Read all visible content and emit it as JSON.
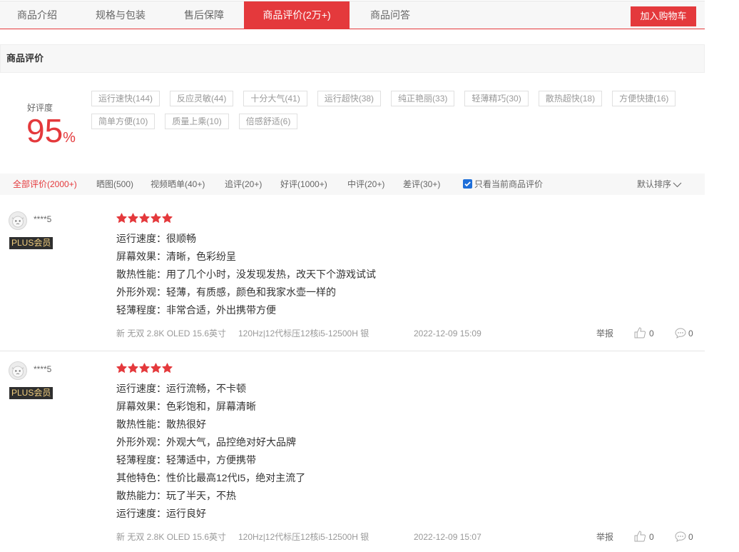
{
  "colors": {
    "accent": "#e4393c",
    "star": "#e4393c",
    "plus_badge_bg": "#2f2f2f",
    "plus_badge_text": "#f2cf7e",
    "checkbox": "#1e6fd9"
  },
  "icons": {
    "star": "star-icon",
    "like": "thumbs-up-icon",
    "comment": "comment-icon",
    "sort": "chevron-down-icon",
    "checkbox": "checkmark-icon",
    "avatar": "default-avatar-icon"
  },
  "tabs": {
    "items": [
      {
        "label": "商品介绍"
      },
      {
        "label": "规格与包装"
      },
      {
        "label": "售后保障"
      },
      {
        "label": "商品评价(2万+)",
        "active": true
      },
      {
        "label": "商品问答"
      }
    ],
    "add_to_cart_label": "加入购物车"
  },
  "section": {
    "title": "商品评价"
  },
  "rating": {
    "label": "好评度",
    "value": "95",
    "unit": "%"
  },
  "tags": [
    "运行速快(144)",
    "反应灵敏(44)",
    "十分大气(41)",
    "运行超快(38)",
    "纯正艳丽(33)",
    "轻薄精巧(30)",
    "散热超快(18)",
    "方便快捷(16)",
    "简单方便(10)",
    "质量上乘(10)",
    "倍感舒适(6)"
  ],
  "filters": {
    "items": [
      {
        "label": "全部评价(2000+)",
        "active": true
      },
      {
        "label": "晒图(500)"
      },
      {
        "label": "视频晒单(40+)"
      },
      {
        "label": "追评(20+)"
      },
      {
        "label": "好评(1000+)"
      },
      {
        "label": "中评(20+)"
      },
      {
        "label": "差评(30+)"
      }
    ],
    "only_current_label": "只看当前商品评价",
    "only_current_checked": true,
    "sort_label": "默认排序"
  },
  "reviews": [
    {
      "username": "****5",
      "badge": "PLUS会员",
      "stars": 5,
      "lines": [
        "运行速度：很顺畅",
        "屏幕效果：清晰，色彩纷呈",
        "散热性能：用了几个小时，没发现发热，改天下个游戏试试",
        "外形外观：轻薄，有质感，颜色和我家水壶一样的",
        "轻薄程度：非常合适，外出携带方便"
      ],
      "spec1": "新 无双 2.8K OLED 15.6英寸",
      "spec2": "120Hz|12代标压12核i5-12500H 银",
      "time": "2022-12-09 15:09",
      "report_label": "举报",
      "likes": "0",
      "comments": "0"
    },
    {
      "username": "****5",
      "badge": "PLUS会员",
      "stars": 5,
      "lines": [
        "运行速度：运行流畅，不卡顿",
        "屏幕效果：色彩饱和，屏幕清晰",
        "散热性能：散热很好",
        "外形外观：外观大气，品控绝对好大品牌",
        "轻薄程度：轻薄适中，方便携带",
        "其他特色：性价比最高12代I5，绝对主流了",
        "散热能力：玩了半天，不热",
        "运行速度：运行良好"
      ],
      "spec1": "新 无双 2.8K OLED 15.6英寸",
      "spec2": "120Hz|12代标压12核i5-12500H 银",
      "time": "2022-12-09 15:07",
      "report_label": "举报",
      "likes": "0",
      "comments": "0"
    }
  ]
}
